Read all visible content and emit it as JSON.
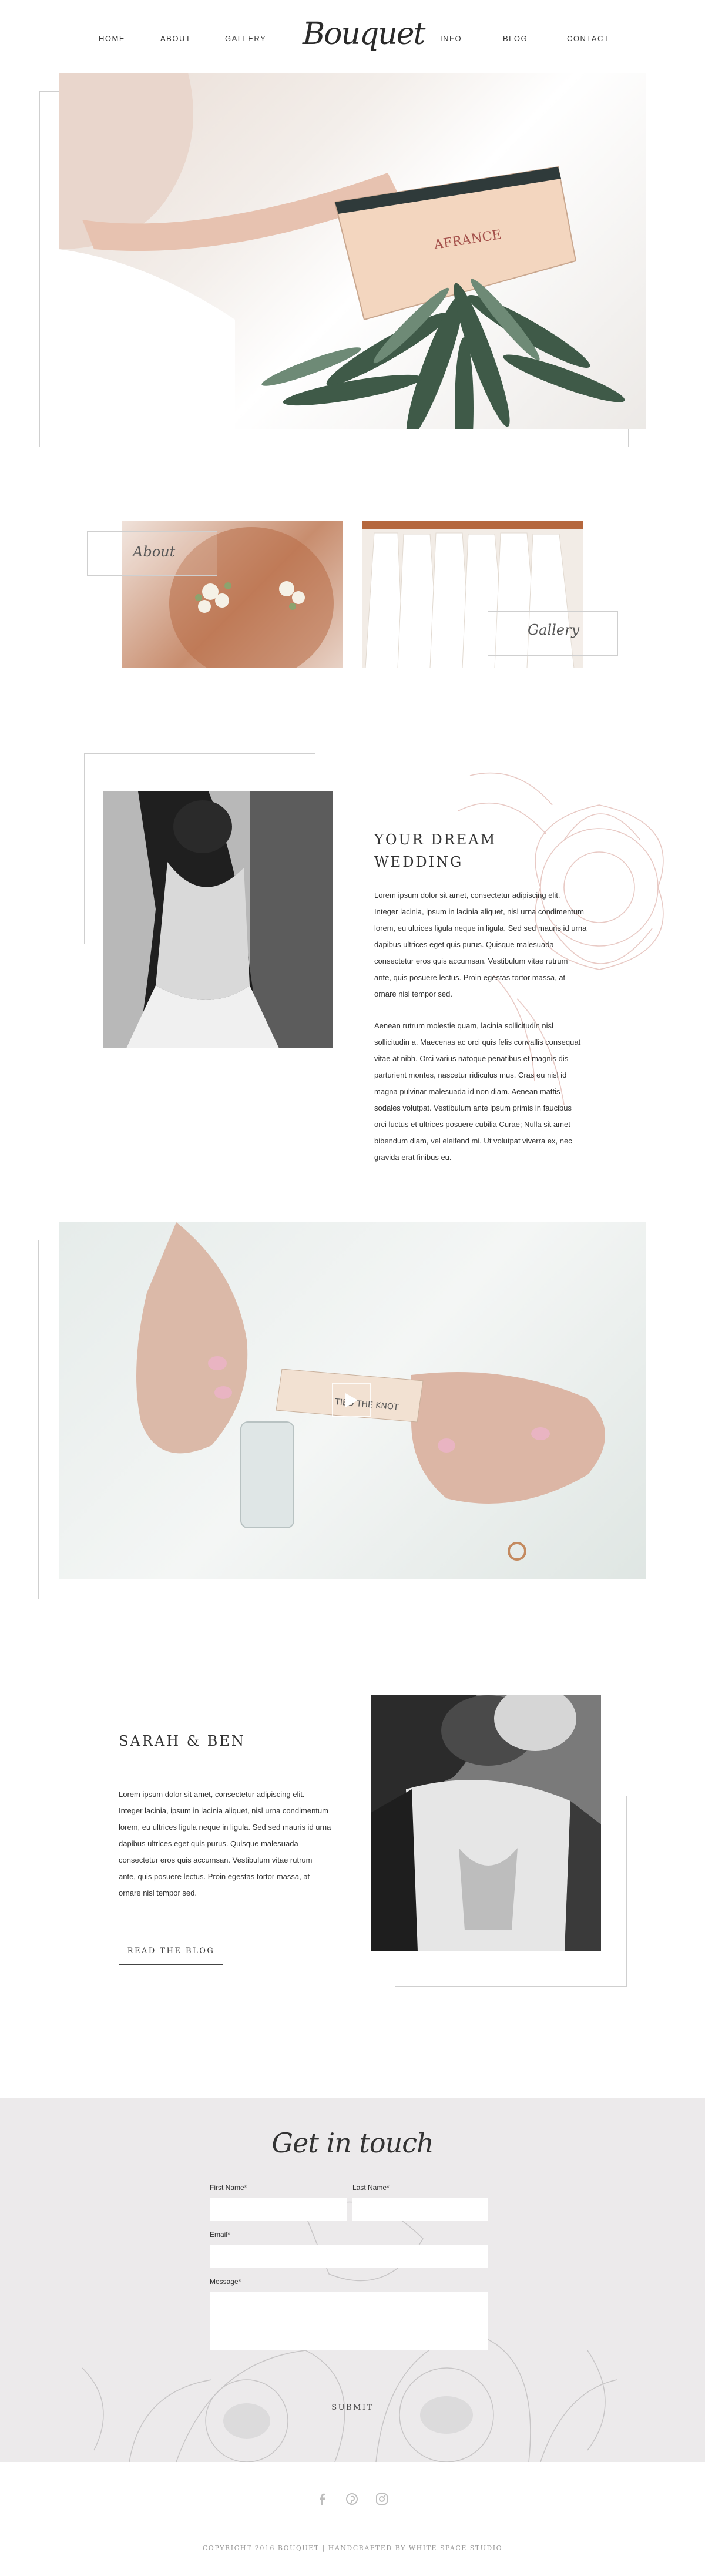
{
  "nav": {
    "left": [
      "HOME",
      "ABOUT",
      "GALLERY"
    ],
    "logo": "Bouquet",
    "right": [
      "INFO",
      "BLOG",
      "CONTACT"
    ]
  },
  "tiles": {
    "about_label": "About",
    "gallery_label": "Gallery"
  },
  "dream": {
    "heading_line1": "YOUR DREAM",
    "heading_line2": "WEDDING",
    "para1_lines": [
      "Lorem ipsum dolor sit amet, consectetur adipiscing elit.",
      "Integer lacinia, ipsum in lacinia aliquet, nisl urna condimentum",
      "lorem, eu ultrices ligula neque in ligula. Sed sed mauris id urna",
      "dapibus ultrices eget quis purus. Quisque malesuada",
      "consectetur eros quis accumsan. Vestibulum vitae rutrum",
      "ante, quis posuere lectus. Proin egestas tortor massa, at",
      "ornare nisl tempor sed."
    ],
    "para2_lines": [
      "Aenean rutrum molestie quam, lacinia sollicitudin nisl",
      "sollicitudin a. Maecenas ac orci quis felis convallis consequat",
      "vitae at nibh. Orci varius natoque penatibus et magnis dis",
      "parturient montes, nascetur ridiculus mus. Cras eu nisl id",
      "magna pulvinar malesuada id non diam. Aenean mattis",
      "sodales volutpat. Vestibulum ante ipsum primis in faucibus",
      "orci luctus et ultrices posuere cubilia Curae; Nulla sit amet",
      "bibendum diam, vel eleifend mi. Ut volutpat viverra ex, nec",
      "gravida erat finibus eu."
    ]
  },
  "video": {
    "tag_text": "TIED THE KNOT"
  },
  "blog": {
    "title": "SARAH & BEN",
    "para_lines": [
      "Lorem ipsum dolor sit amet, consectetur adipiscing elit.",
      "Integer lacinia, ipsum in lacinia aliquet, nisl urna condimentum",
      "lorem, eu ultrices ligula neque in ligula. Sed sed mauris id urna",
      "dapibus ultrices eget quis purus. Quisque malesuada",
      "consectetur eros quis accumsan. Vestibulum vitae rutrum",
      "ante, quis posuere lectus. Proin egestas tortor massa, at",
      "ornare nisl tempor sed."
    ],
    "button": "READ THE BLOG"
  },
  "contact": {
    "title": "Get in touch",
    "first_name_label": "First Name*",
    "last_name_label": "Last Name*",
    "email_label": "Email*",
    "message_label": "Message*",
    "submit": "SUBMIT"
  },
  "footer": {
    "icons": [
      "facebook-icon",
      "pinterest-icon",
      "instagram-icon"
    ],
    "copyright": "COPYRIGHT 2016 BOUQUET | HANDCRAFTED BY WHITE SPACE STUDIO"
  },
  "colors": {
    "accent_pink": "#e8c9c4",
    "contact_bg": "#eceaeb"
  }
}
